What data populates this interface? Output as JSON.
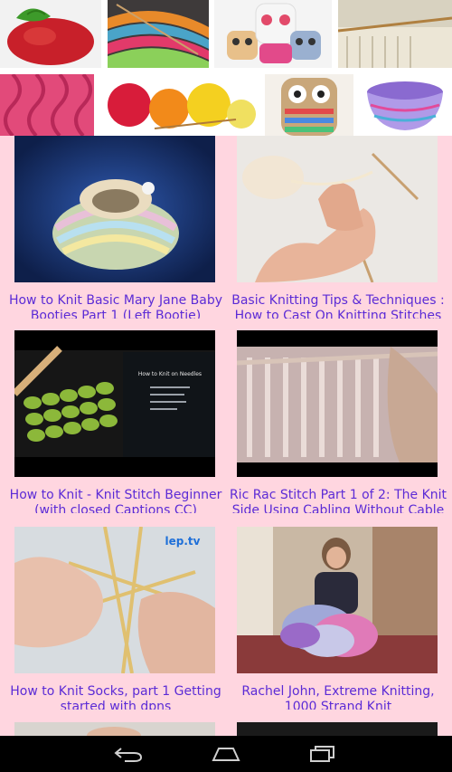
{
  "banner": {
    "images": [
      {
        "name": "apple-knit-image"
      },
      {
        "name": "striped-knitting-image"
      },
      {
        "name": "knitted-owls-image"
      },
      {
        "name": "knitting-needles-image"
      },
      {
        "name": "cable-knit-image"
      },
      {
        "name": "yarn-balls-image"
      },
      {
        "name": "owl-pillow-image"
      },
      {
        "name": "knitted-bowl-image"
      }
    ]
  },
  "videos": [
    {
      "title": "How to Knit Basic Mary Jane Baby Booties Part 1 (Left Bootie)"
    },
    {
      "title": "Basic Knitting Tips & Techniques : How to Cast On Knitting Stitches"
    },
    {
      "title": "How to Knit - Knit Stitch Beginner (with closed Captions CC)"
    },
    {
      "title": "Ric Rac Stitch Part 1 of 2: The Knit Side Using Cabling Without Cable"
    },
    {
      "title": "How to Knit Socks, part 1 Getting started with dpns"
    },
    {
      "title": "Rachel John, Extreme Knitting, 1000 Strand Knit"
    }
  ],
  "thumb_labels": {
    "knit_title": "How to Knit on Needles",
    "logo": "lep.tv"
  },
  "colors": {
    "background": "#ffd6e0",
    "caption": "#5b2bd6",
    "navbar": "#000000"
  },
  "nav": {
    "icons": [
      "back-icon",
      "home-icon",
      "recent-apps-icon"
    ]
  }
}
